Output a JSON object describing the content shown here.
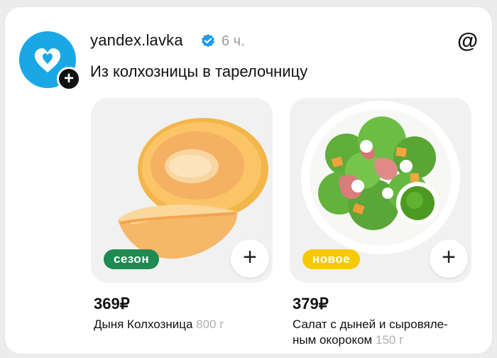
{
  "post": {
    "username": "yandex.lavka",
    "time": "6 ч.",
    "text": "Из колхозницы в тарелочницу",
    "icons": {
      "avatar": "yandex-lavka-heart-logo",
      "follow": "plus-icon",
      "verified": "verified-badge-icon",
      "app": "threads-icon"
    },
    "follow_label": "+",
    "threads_glyph": "@"
  },
  "products": [
    {
      "tag": "сезон",
      "tag_color": "#1f8a52",
      "add_label": "+",
      "price": "369₽",
      "name": "Дыня Колхозница",
      "weight": "800 г",
      "image": "cantaloupe-melon-slices"
    },
    {
      "tag": "новое",
      "tag_color": "#f7c900",
      "add_label": "+",
      "price": "379₽",
      "name": "Салат с дыней и сыровяле-ным окороком",
      "weight": "150 г",
      "image": "salad-plate-with-prosciutto-melon-mozzarella-pesto"
    }
  ],
  "colors": {
    "avatar": "#1aa7e6",
    "verified": "#1d9bf0",
    "muted": "#9a9a9a"
  }
}
